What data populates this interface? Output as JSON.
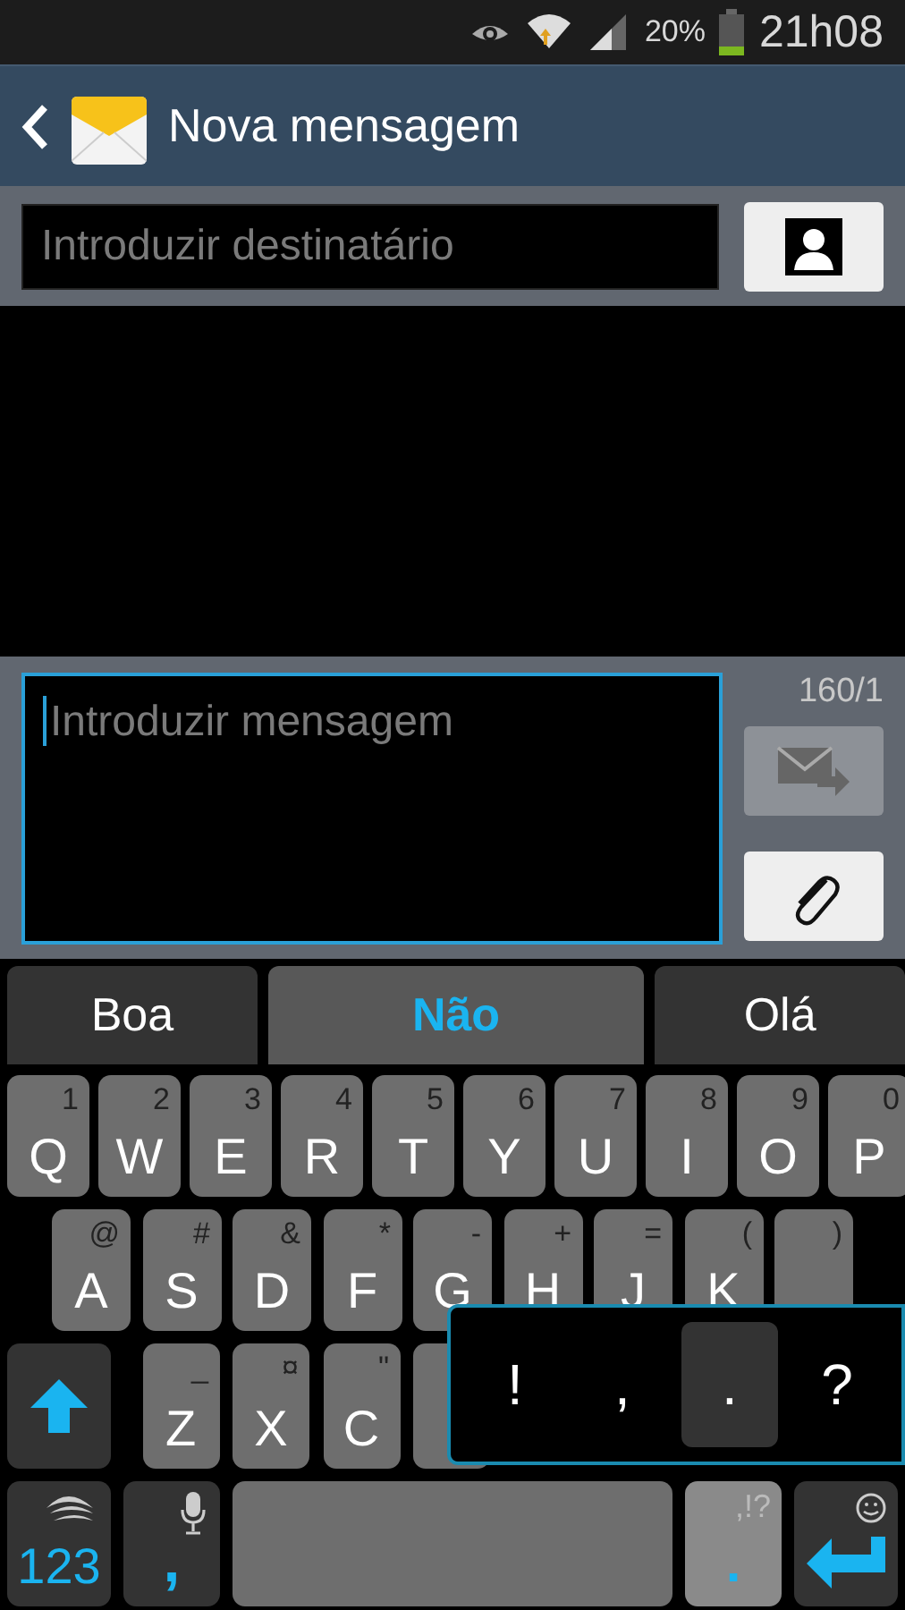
{
  "status_bar": {
    "battery": "20%",
    "time": "21h08"
  },
  "action_bar": {
    "title": "Nova mensagem"
  },
  "recipient": {
    "placeholder": "Introduzir destinatário"
  },
  "compose": {
    "placeholder": "Introduzir mensagem",
    "counter": "160/1",
    "send_disabled": true
  },
  "suggestions": [
    {
      "label": "Boa",
      "selected": false
    },
    {
      "label": "Não",
      "selected": true
    },
    {
      "label": "Olá",
      "selected": false
    }
  ],
  "keyboard": {
    "rows": [
      [
        {
          "main": "Q",
          "alt": "1"
        },
        {
          "main": "W",
          "alt": "2"
        },
        {
          "main": "E",
          "alt": "3"
        },
        {
          "main": "R",
          "alt": "4"
        },
        {
          "main": "T",
          "alt": "5"
        },
        {
          "main": "Y",
          "alt": "6"
        },
        {
          "main": "U",
          "alt": "7"
        },
        {
          "main": "I",
          "alt": "8"
        },
        {
          "main": "O",
          "alt": "9"
        },
        {
          "main": "P",
          "alt": "0"
        }
      ],
      [
        {
          "main": "A",
          "alt": "@"
        },
        {
          "main": "S",
          "alt": "#"
        },
        {
          "main": "D",
          "alt": "&"
        },
        {
          "main": "F",
          "alt": "*"
        },
        {
          "main": "G",
          "alt": "-"
        },
        {
          "main": "H",
          "alt": "+"
        },
        {
          "main": "J",
          "alt": "="
        },
        {
          "main": "K",
          "alt": "("
        },
        {
          "alt": ")"
        }
      ],
      [
        {
          "main": "Z",
          "alt": "_"
        },
        {
          "main": "X",
          "alt": "¤"
        },
        {
          "main": "C",
          "alt": "\""
        },
        {}
      ]
    ],
    "numbers_key": "123",
    "comma_key": ",",
    "period_key": {
      "main": ".",
      "alt": ",!?"
    },
    "popup": [
      {
        "label": "!",
        "selected": false
      },
      {
        "label": ",",
        "selected": false
      },
      {
        "label": ".",
        "selected": true
      },
      {
        "label": "?",
        "selected": false
      }
    ]
  }
}
